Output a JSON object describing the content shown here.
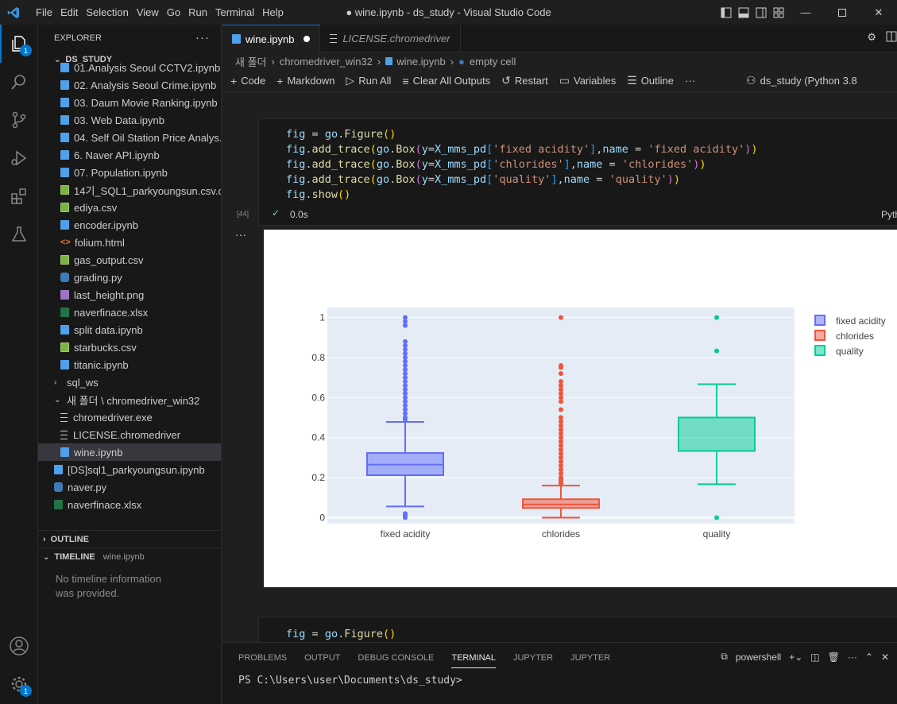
{
  "window": {
    "title": "● wine.ipynb - ds_study - Visual Studio Code",
    "menu": [
      "File",
      "Edit",
      "Selection",
      "View",
      "Go",
      "Run",
      "Terminal",
      "Help"
    ]
  },
  "activity": {
    "explorer_badge": "1",
    "settings_badge": "1"
  },
  "sidebar": {
    "header": "EXPLORER",
    "section": "DS_STUDY",
    "items": [
      {
        "label": "01.Analysis Seoul CCTV2.ipynb",
        "icon": "notebook-icon",
        "indent": 1
      },
      {
        "label": "02. Analysis Seoul Crime.ipynb",
        "icon": "notebook-icon",
        "indent": 1
      },
      {
        "label": "03. Daum Movie Ranking.ipynb",
        "icon": "notebook-icon",
        "indent": 1
      },
      {
        "label": "03. Web Data.ipynb",
        "icon": "notebook-icon",
        "indent": 1
      },
      {
        "label": "04. Self Oil Station Price Analys...",
        "icon": "notebook-icon",
        "indent": 1
      },
      {
        "label": "6. Naver API.ipynb",
        "icon": "notebook-icon",
        "indent": 1
      },
      {
        "label": "07. Population.ipynb",
        "icon": "notebook-icon",
        "indent": 1
      },
      {
        "label": "14기_SQL1_parkyoungsun.csv.c...",
        "icon": "csv-icon",
        "indent": 1
      },
      {
        "label": "ediya.csv",
        "icon": "csv-icon",
        "indent": 1
      },
      {
        "label": "encoder.ipynb",
        "icon": "notebook-icon",
        "indent": 1
      },
      {
        "label": "folium.html",
        "icon": "html-icon",
        "indent": 1
      },
      {
        "label": "gas_output.csv",
        "icon": "csv-icon",
        "indent": 1
      },
      {
        "label": "grading.py",
        "icon": "python-icon",
        "indent": 1
      },
      {
        "label": "last_height.png",
        "icon": "image-icon",
        "indent": 1
      },
      {
        "label": "naverfinace.xlsx",
        "icon": "excel-icon",
        "indent": 1
      },
      {
        "label": "split data.ipynb",
        "icon": "notebook-icon",
        "indent": 1
      },
      {
        "label": "starbucks.csv",
        "icon": "csv-icon",
        "indent": 1
      },
      {
        "label": "titanic.ipynb",
        "icon": "notebook-icon",
        "indent": 1
      },
      {
        "label": "sql_ws",
        "icon": "folder-collapsed",
        "indent": 0
      },
      {
        "label": "새 폴더 \\ chromedriver_win32",
        "icon": "folder-expanded",
        "indent": 0
      },
      {
        "label": "chromedriver.exe",
        "icon": "text-icon",
        "indent": 1
      },
      {
        "label": "LICENSE.chromedriver",
        "icon": "text-icon",
        "indent": 1
      },
      {
        "label": "wine.ipynb",
        "icon": "notebook-icon",
        "indent": 1,
        "selected": true
      },
      {
        "label": "[DS]sql1_parkyoungsun.ipynb",
        "icon": "notebook-icon",
        "indent": 0
      },
      {
        "label": "naver.py",
        "icon": "python-icon",
        "indent": 0
      },
      {
        "label": "naverfinace.xlsx",
        "icon": "excel-icon",
        "indent": 0
      }
    ],
    "outline": "OUTLINE",
    "timeline": "TIMELINE",
    "timeline_file": "wine.ipynb",
    "timeline_msg": "No timeline information was provided."
  },
  "tabs": [
    {
      "label": "wine.ipynb",
      "active": true
    },
    {
      "label": "LICENSE.chromedriver",
      "active": false
    }
  ],
  "breadcrumb": [
    "새 폴더",
    "chromedriver_win32",
    "wine.ipynb",
    "empty cell"
  ],
  "toolbar": {
    "code": "Code",
    "markdown": "Markdown",
    "run_all": "Run All",
    "clear": "Clear All Outputs",
    "restart": "Restart",
    "variables": "Variables",
    "outline": "Outline",
    "kernel": "ds_study (Python 3.8"
  },
  "cell": {
    "exec": "[44]",
    "time": "0.0s",
    "lang": "Pyth"
  },
  "next_cell_code": "fig = go.Figure()",
  "chart_data": {
    "type": "box",
    "categories": [
      "fixed acidity",
      "chlorides",
      "quality"
    ],
    "series": [
      {
        "name": "fixed acidity",
        "color": "#636efa",
        "min": 0.056,
        "q1": 0.212,
        "median": 0.265,
        "q3": 0.323,
        "max": 0.478,
        "outliers": [
          0,
          0.01,
          0.02,
          0.49,
          0.5,
          0.52,
          0.54,
          0.56,
          0.58,
          0.6,
          0.62,
          0.64,
          0.66,
          0.68,
          0.7,
          0.72,
          0.74,
          0.76,
          0.78,
          0.8,
          0.82,
          0.84,
          0.86,
          0.88,
          0.96,
          0.98,
          1
        ]
      },
      {
        "name": "chlorides",
        "color": "#ef553b",
        "min": 0.0,
        "q1": 0.048,
        "median": 0.066,
        "q3": 0.092,
        "max": 0.16,
        "outliers": [
          0.17,
          0.18,
          0.19,
          0.2,
          0.22,
          0.24,
          0.26,
          0.28,
          0.3,
          0.32,
          0.34,
          0.36,
          0.38,
          0.4,
          0.42,
          0.44,
          0.46,
          0.48,
          0.5,
          0.54,
          0.58,
          0.6,
          0.62,
          0.64,
          0.66,
          0.68,
          0.72,
          0.75,
          0.76,
          1
        ]
      },
      {
        "name": "quality",
        "color": "#00cc96",
        "min": 0.167,
        "q1": 0.333,
        "median": 0.5,
        "q3": 0.5,
        "max": 0.667,
        "outliers": [
          0,
          0.833,
          1
        ]
      }
    ],
    "yticks": [
      "0",
      "0.2",
      "0.4",
      "0.6",
      "0.8",
      "1"
    ],
    "ylim": [
      -0.03,
      1.05
    ],
    "legend": "top-right"
  },
  "panel": {
    "tabs": [
      "PROBLEMS",
      "OUTPUT",
      "DEBUG CONSOLE",
      "TERMINAL",
      "JUPYTER",
      "JUPYTER"
    ],
    "shell": "powershell",
    "prompt": "PS C:\\Users\\user\\Documents\\ds_study>"
  }
}
